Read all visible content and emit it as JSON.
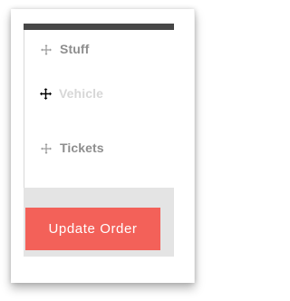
{
  "sortable_list": {
    "items": [
      {
        "label": "Stuff",
        "handle_icon": "move-icon",
        "state": "normal"
      },
      {
        "label": "Vehicle",
        "handle_icon": "move-cursor-icon",
        "state": "dragging"
      },
      {
        "label": "Tickets",
        "handle_icon": "move-icon",
        "state": "normal"
      }
    ]
  },
  "footer": {
    "update_button_label": "Update Order"
  },
  "colors": {
    "header_bar": "#474747",
    "footer_bg": "#e4e4e4",
    "button_bg": "#f36159",
    "label_text": "#8e8e8e",
    "dragging_text": "#d7d7d7"
  }
}
